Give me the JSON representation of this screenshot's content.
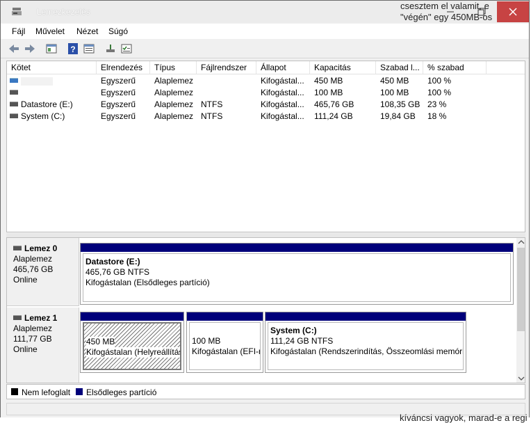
{
  "window": {
    "title": "Lemezkezelés",
    "background_text_line1": "csesztem el valamit, e",
    "background_text_line2": "\"végén\" egy 450MB-os",
    "bottom_text": "kíváncsi vagyok, marad-e a regi"
  },
  "menu": [
    "Fájl",
    "Művelet",
    "Nézet",
    "Súgó"
  ],
  "columns": [
    "Kötet",
    "Elrendezés",
    "Típus",
    "Fájlrendszer",
    "Állapot",
    "Kapacitás",
    "Szabad l...",
    "% szabad"
  ],
  "volumes": [
    {
      "name": "",
      "layout": "Egyszerű",
      "type": "Alaplemez",
      "fs": "",
      "status": "Kifogástal...",
      "capacity": "450 MB",
      "free": "450 MB",
      "pct": "100 %"
    },
    {
      "name": "",
      "layout": "Egyszerű",
      "type": "Alaplemez",
      "fs": "",
      "status": "Kifogástal...",
      "capacity": "100 MB",
      "free": "100 MB",
      "pct": "100 %"
    },
    {
      "name": "Datastore (E:)",
      "layout": "Egyszerű",
      "type": "Alaplemez",
      "fs": "NTFS",
      "status": "Kifogástal...",
      "capacity": "465,76 GB",
      "free": "108,35 GB",
      "pct": "23 %"
    },
    {
      "name": "System (C:)",
      "layout": "Egyszerű",
      "type": "Alaplemez",
      "fs": "NTFS",
      "status": "Kifogástal...",
      "capacity": "111,24 GB",
      "free": "19,84 GB",
      "pct": "18 %"
    }
  ],
  "disk0": {
    "name": "Lemez 0",
    "type": "Alaplemez",
    "size": "465,76 GB",
    "state": "Online",
    "p1_title": "Datastore  (E:)",
    "p1_size": "465,76 GB NTFS",
    "p1_status": "Kifogástalan (Elsődleges partíció)"
  },
  "disk1": {
    "name": "Lemez 1",
    "type": "Alaplemez",
    "size": "111,77 GB",
    "state": "Online",
    "p1_size": "450 MB",
    "p1_status": "Kifogástalan (Helyreállítás",
    "p2_size": "100 MB",
    "p2_status": "Kifogástalan (EFI-re",
    "p3_title": "System  (C:)",
    "p3_size": "111,24 GB NTFS",
    "p3_status": "Kifogástalan (Rendszerindítás, Összeomlási memória"
  },
  "legend": {
    "unallocated": "Nem lefoglalt",
    "primary": "Elsődleges partíció"
  },
  "colors": {
    "primary_partition": "#00007a",
    "close_button": "#c74343"
  }
}
